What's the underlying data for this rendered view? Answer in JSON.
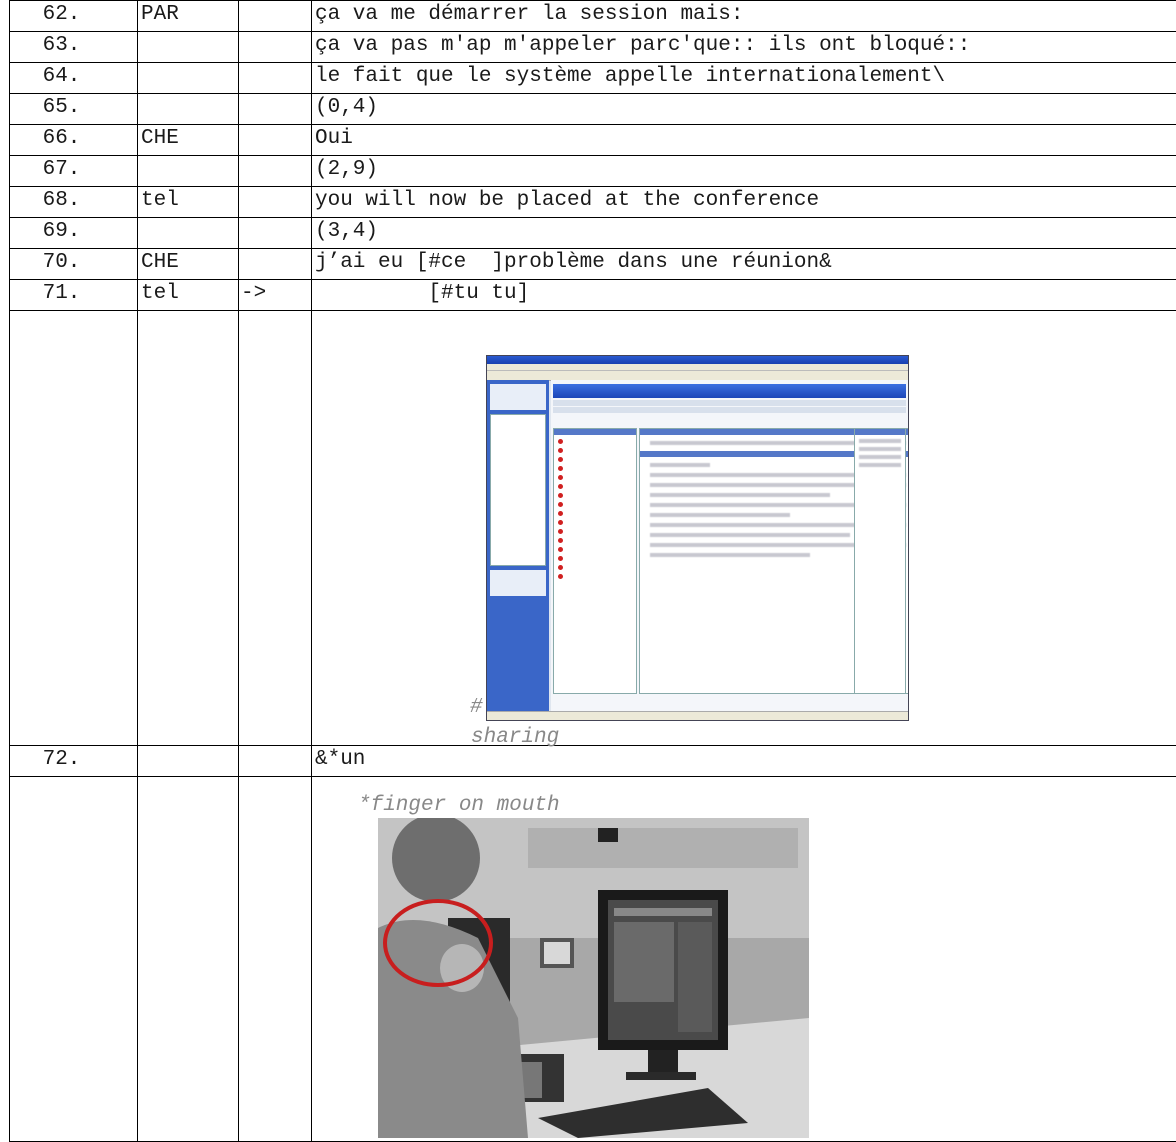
{
  "rows": [
    {
      "num": "62.",
      "speaker": "PAR",
      "arrow": "",
      "text": "ça va me démarrer la session mais:"
    },
    {
      "num": "63.",
      "speaker": "",
      "arrow": "",
      "text": "ça va pas m'ap m'appeler parc'que:: ils ont bloqué::"
    },
    {
      "num": "64.",
      "speaker": "",
      "arrow": "",
      "text": "le fait que le système appelle internationalement\\"
    },
    {
      "num": "65.",
      "speaker": "",
      "arrow": "",
      "text": "(0,4)"
    },
    {
      "num": "66.",
      "speaker": "CHE",
      "arrow": "",
      "text": "Oui"
    },
    {
      "num": "67.",
      "speaker": "",
      "arrow": "",
      "text": "(2,9)"
    },
    {
      "num": "68.",
      "speaker": "tel",
      "arrow": "",
      "text": "you will now be placed at the conference"
    },
    {
      "num": "69.",
      "speaker": "",
      "arrow": "",
      "text": "(3,4)"
    },
    {
      "num": "70.",
      "speaker": "CHE",
      "arrow": "",
      "text": "j’ai eu [#ce  ]problème dans une réunion&"
    },
    {
      "num": "71.",
      "speaker": "tel",
      "arrow": "->",
      "text": "         [#tu tu]"
    }
  ],
  "image_row_1": {
    "annotation_mark": "#",
    "annotation_label": "sharing"
  },
  "row_72": {
    "num": "72.",
    "speaker": "",
    "arrow": "",
    "text": "&*un"
  },
  "image_row_2": {
    "annotation_label": "*finger on mouth"
  },
  "colors": {
    "annotation_gray": "#888888",
    "circle_red": "#c81e1e",
    "window_blue": "#2a5ad0"
  }
}
